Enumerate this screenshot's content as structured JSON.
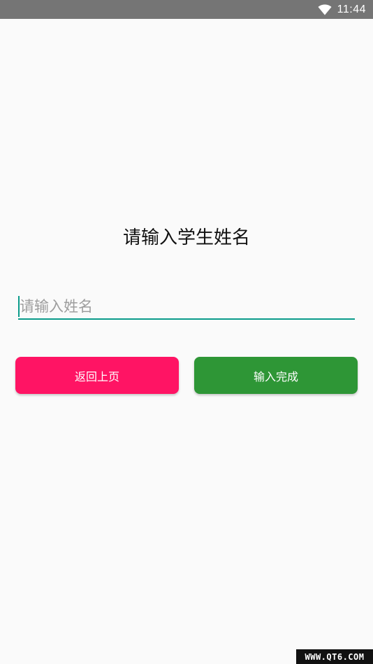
{
  "status_bar": {
    "time": "11:44",
    "wifi_icon": "wifi-icon",
    "background": "#757575"
  },
  "main": {
    "title": "请输入学生姓名",
    "name_input": {
      "value": "",
      "placeholder": "请输入姓名"
    },
    "buttons": {
      "back_label": "返回上页",
      "done_label": "输入完成"
    }
  },
  "watermark": {
    "text": "WWW.QT6.COM"
  },
  "colors": {
    "accent": "#0a9b8a",
    "back_button": "#ff1464",
    "done_button": "#2e9636",
    "background": "#fafafa"
  }
}
